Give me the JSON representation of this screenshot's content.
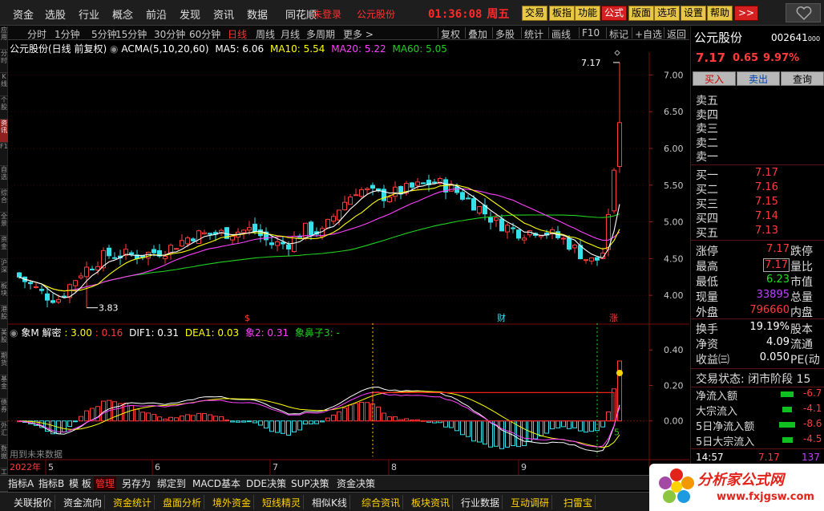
{
  "topbar": {
    "menus": [
      "资金",
      "选股",
      "行业",
      "概念",
      "前沿",
      "发现",
      "资讯",
      "数据",
      "同花顺"
    ],
    "login_status": "未登录",
    "stock_name": "公元股份",
    "time": "01:36:08",
    "weekday": "周五",
    "buttons": [
      "交易",
      "板指",
      "功能",
      "公式",
      "版面",
      "选项",
      "设置",
      "帮助"
    ],
    "more": ">>"
  },
  "left_tabs": [
    "应用",
    "分时",
    "K线",
    "个股",
    "资讯",
    "F10",
    "自选",
    "综合",
    "全景",
    "资金",
    "沪深",
    "板块",
    "港股",
    "美股",
    "期货",
    "基金",
    "债券",
    "外汇",
    "数据",
    "工具"
  ],
  "period_bar": {
    "items": [
      "分时",
      "1分钟",
      "5分钟",
      "15分钟",
      "30分钟",
      "60分钟",
      "日线",
      "周线",
      "月线",
      "多周期",
      "更多 >"
    ],
    "active": "日线",
    "tools": [
      "复权",
      "叠加",
      "多股",
      "统计",
      "画线",
      "F10",
      "标记",
      "+自选",
      "返回"
    ]
  },
  "indicator_bar": {
    "title": "公元股份(日线 前复权)",
    "acma_label": "ACMA(5,10,20,60)",
    "ma5": "MA5: 6.06",
    "ma10": "MA10: 5.54",
    "ma20": "MA20: 5.22",
    "ma60": "MA60: 5.05"
  },
  "macd_bar": {
    "name": "象M 解密",
    "v1": ": 3.00",
    "v2": ": 0.16",
    "dif": "DIF1: 0.31",
    "dea": "DEA1: 0.03",
    "xiang2": "象2: 0.31",
    "nose": "象鼻子3: -"
  },
  "chart_data": [
    {
      "type": "candlestick",
      "price_axis": [
        "7.00",
        "6.50",
        "6.00",
        "5.50",
        "5.00",
        "4.50",
        "4.00"
      ],
      "ylim": [
        3.75,
        7.3
      ],
      "high_label": "7.17",
      "low_label": "3.83",
      "markers": [
        "$",
        "财",
        "涨"
      ],
      "time_axis": [
        "2022年",
        "5",
        "6",
        "7",
        "8",
        "9"
      ],
      "ma_lines": [
        "MA5",
        "MA10",
        "MA20",
        "MA60"
      ]
    },
    {
      "type": "bar",
      "name": "象M 解密",
      "y_axis": [
        "0.40",
        "0.20",
        "0.00"
      ],
      "ylim": [
        -0.2,
        0.55
      ],
      "signal_label": "5",
      "watermark": "用到未来数据"
    }
  ],
  "quote": {
    "name": "公元股份",
    "code": "002641",
    "code_suffix": "000",
    "price": "7.17",
    "change": "0.65",
    "pct": "9.97%",
    "buy_btn": "买入",
    "sell_btn": "卖出",
    "query_btn": "查询",
    "asks": [
      {
        "label": "卖五",
        "price": ""
      },
      {
        "label": "卖四",
        "price": ""
      },
      {
        "label": "卖三",
        "price": ""
      },
      {
        "label": "卖二",
        "price": ""
      },
      {
        "label": "卖一",
        "price": ""
      }
    ],
    "bids": [
      {
        "label": "买一",
        "price": "7.17"
      },
      {
        "label": "买二",
        "price": "7.16"
      },
      {
        "label": "买三",
        "price": "7.15"
      },
      {
        "label": "买四",
        "price": "7.14"
      },
      {
        "label": "买五",
        "price": "7.13"
      }
    ],
    "stats": [
      {
        "l1": "涨停",
        "v1": "7.17",
        "l2": "跌停"
      },
      {
        "l1": "最高",
        "v1": "7.17",
        "l2": "量比"
      },
      {
        "l1": "最低",
        "v1": "6.23",
        "l2": "市值"
      },
      {
        "l1": "现量",
        "v1": "33895",
        "l2": "总量"
      },
      {
        "l1": "外盘",
        "v1": "796660",
        "l2": "内盘"
      }
    ],
    "stats2": [
      {
        "l1": "换手",
        "v1": "19.19%",
        "l2": "股本"
      },
      {
        "l1": "净资",
        "v1": "4.09",
        "l2": "流通"
      },
      {
        "l1": "收益㈢",
        "v1": "0.050",
        "l2": "PE(动"
      }
    ],
    "trade_status": "交易状态: 闭市阶段 15",
    "flows": [
      {
        "label": "净流入额",
        "value": "-6.7",
        "bar": 16
      },
      {
        "label": "大宗流入",
        "value": "-4.1",
        "bar": 12
      },
      {
        "label": "5日净流入额",
        "value": "-8.6",
        "bar": 20
      },
      {
        "label": "5日大宗流入",
        "value": "-4.5",
        "bar": 13
      }
    ],
    "tick": {
      "time": "14:57",
      "price": "7.17",
      "vol": "137"
    }
  },
  "bottom_tabs_1": [
    "指标A",
    "指标B",
    "模 板",
    "管理",
    "另存为",
    "绑定到",
    "MACD基本",
    "DDE决策",
    "SUP决策",
    "资金决策"
  ],
  "bottom_tabs_1_active": "管理",
  "bottom_tabs_2": [
    "关联报价",
    "资金流向",
    "资金统计",
    "盘面分析",
    "境外资金",
    "短线精灵",
    "相似K线",
    "综合资讯",
    "板块资讯",
    "行业数据",
    "互动调研",
    "扫雷宝"
  ],
  "watermark": {
    "name": "分析家公式网",
    "url": "www.fxjgsw.com"
  },
  "colors": {
    "up": "#ff3b3b",
    "down": "#35e0e8",
    "ma5": "#ffffff",
    "ma10": "#ffff00",
    "ma20": "#ff40ff",
    "ma60": "#20d020"
  }
}
